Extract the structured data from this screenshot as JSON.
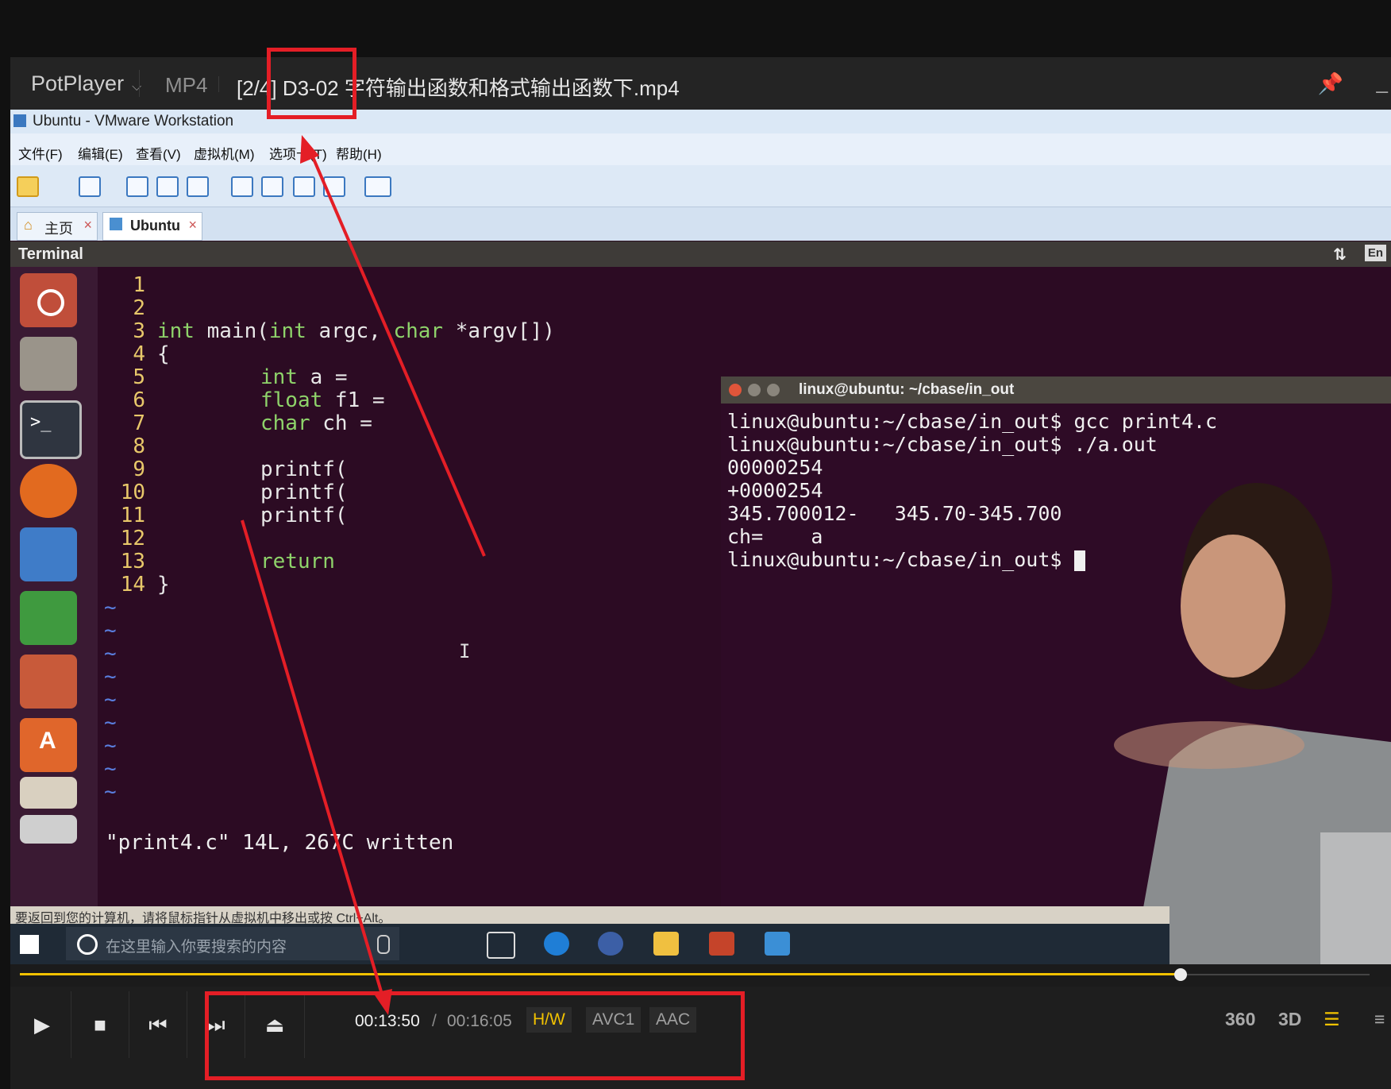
{
  "player": {
    "brand": "PotPlayer",
    "format": "MP4",
    "filename": "[2/4] D3-02 字符输出函数和格式输出函数下.mp4"
  },
  "vmware": {
    "title": "Ubuntu - VMware Workstation",
    "menu": [
      "文件(F)",
      "编辑(E)",
      "查看(V)",
      "虚拟机(M)",
      "选项卡(T)",
      "帮助(H)"
    ],
    "tabs": [
      "主页",
      "Ubuntu"
    ],
    "terminal_label": "Terminal",
    "lang": "En",
    "notice": "要返回到您的计算机，请将鼠标指针从虚拟机中移出或按 Ctrl+Alt。",
    "search_placeholder": "在这里输入你要搜索的内容"
  },
  "editor": {
    "line_numbers": [
      "1",
      "2",
      "3",
      "4",
      "5",
      "6",
      "7",
      "8",
      "9",
      "10",
      "11",
      "12",
      "13",
      "14"
    ],
    "status_line": "\"print4.c\" 14L, 267C written"
  },
  "terminal": {
    "title": "linux@ubuntu: ~/cbase/in_out",
    "lines": [
      "linux@ubuntu:~/cbase/in_out$ gcc print4.c",
      "linux@ubuntu:~/cbase/in_out$ ./a.out",
      "00000254",
      "+0000254",
      "345.700012-   345.70-345.700",
      "ch=    a"
    ],
    "prompt": "linux@ubuntu:~/cbase/in_out$ "
  },
  "controls": {
    "elapsed": "00:13:50",
    "separator": "/",
    "total": "00:16:05",
    "tags": [
      "H/W",
      "AVC1",
      "AAC"
    ],
    "right_icons": [
      "360",
      "3D"
    ],
    "progress": 0.86
  },
  "colors": {
    "accent": "#f2c200",
    "annotation": "#e41e26"
  }
}
